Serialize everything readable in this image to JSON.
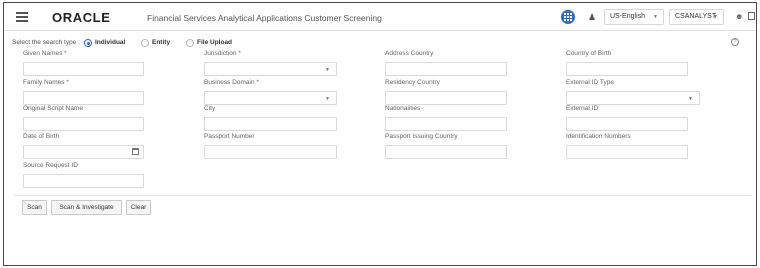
{
  "header": {
    "menu_icon": "hamburger-icon",
    "brand": "ORACLE",
    "product": "Financial Services Analytical Applications Customer Screening",
    "apps_icon": "grid-apps-icon",
    "accessibility_icon": "accessibility-icon",
    "language": "US-English",
    "user": "CSANALYST",
    "user_icon": "user-icon",
    "window_icon": "window-icon"
  },
  "search_type": {
    "label": "Select the search type :",
    "options": [
      {
        "label": "Individual",
        "selected": true
      },
      {
        "label": "Entity",
        "selected": false
      },
      {
        "label": "File Upload",
        "selected": false
      }
    ],
    "help_icon": "help-icon"
  },
  "fields": [
    {
      "label": "Given Names *",
      "value": "",
      "type": "text"
    },
    {
      "label": "Jurisdiction *",
      "value": "",
      "type": "select"
    },
    {
      "label": "Address Country",
      "value": "",
      "type": "text"
    },
    {
      "label": "Country of Birth",
      "value": "",
      "type": "text"
    },
    {
      "label": "Family Names *",
      "value": "",
      "type": "text"
    },
    {
      "label": "Business Domain *",
      "value": "",
      "type": "select"
    },
    {
      "label": "Residency Country",
      "value": "",
      "type": "text"
    },
    {
      "label": "External ID Type",
      "value": "",
      "type": "select"
    },
    {
      "label": "Original Script Name",
      "value": "",
      "type": "text"
    },
    {
      "label": "City",
      "value": "",
      "type": "text"
    },
    {
      "label": "Nationalities",
      "value": "",
      "type": "text"
    },
    {
      "label": "External ID",
      "value": "",
      "type": "text"
    },
    {
      "label": "Date of Birth",
      "value": "",
      "type": "date"
    },
    {
      "label": "Passport Number",
      "value": "",
      "type": "text"
    },
    {
      "label": "Passport Issuing Country",
      "value": "",
      "type": "text"
    },
    {
      "label": "Identification Numbers",
      "value": "",
      "type": "text"
    },
    {
      "label": "Source Request ID",
      "value": "",
      "type": "text"
    }
  ],
  "actions": {
    "scan": "Scan",
    "scan_investigate": "Scan & Investigate",
    "clear": "Clear"
  },
  "colors": {
    "accent": "#2b6cc4",
    "border": "#d9d9d9"
  }
}
